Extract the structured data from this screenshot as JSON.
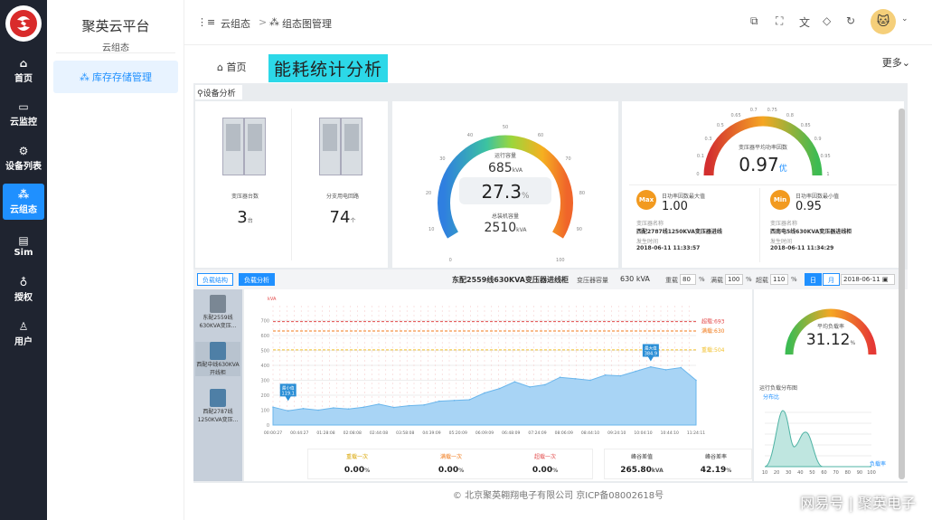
{
  "rail": {
    "items": [
      {
        "label": "首页",
        "icon": "home-icon"
      },
      {
        "label": "云监控",
        "icon": "monitor-icon"
      },
      {
        "label": "设备列表",
        "icon": "device-icon"
      },
      {
        "label": "云组态",
        "icon": "config-icon"
      },
      {
        "label": "Sim",
        "icon": "sim-icon"
      },
      {
        "label": "授权",
        "icon": "auth-icon"
      },
      {
        "label": "用户",
        "icon": "user-icon"
      }
    ]
  },
  "sidebar": {
    "title": "聚英云平台",
    "subtitle": "云组态",
    "menu_item": "库存存储管理"
  },
  "topbar": {
    "crumb1": "云组态",
    "crumb2": "组态图管理",
    "sep": ">"
  },
  "tabs": {
    "home": "首页",
    "page_title": "能耗统计分析",
    "more": "更多"
  },
  "section": {
    "title": "设备分析"
  },
  "card1": {
    "a_label": "变压器台数",
    "a_value": "3",
    "a_unit": "台",
    "b_label": "分支用电回路",
    "b_value": "74",
    "b_unit": "个"
  },
  "gauge1": {
    "top_label": "运行容量",
    "top_value": "685",
    "top_unit": "kVA",
    "percent": "27.3",
    "pct_sign": "%",
    "bottom_label": "总装机容量",
    "bottom_value": "2510",
    "bottom_unit": "kVA",
    "ticks": [
      "0",
      "10",
      "20",
      "30",
      "40",
      "50",
      "60",
      "70",
      "80",
      "90",
      "100"
    ]
  },
  "gauge2": {
    "label": "变压器平均功率因数",
    "value": "0.97",
    "badge": "优",
    "ticks": [
      "0",
      "0.1",
      "0.3",
      "0.5",
      "0.65",
      "0.7",
      "0.75",
      "0.8",
      "0.85",
      "0.9",
      "0.95",
      "1"
    ]
  },
  "maxmin": {
    "max": {
      "badge": "Max",
      "title": "日功率因数最大值",
      "value": "1.00",
      "name_label": "变压器名称",
      "name": "西配2787线1250KVA变压器进线",
      "time_label": "发生时间",
      "time": "2018-06-11 11:33:57"
    },
    "min": {
      "badge": "Min",
      "title": "日功率因数最小值",
      "value": "0.95",
      "name_label": "变压器名称",
      "name": "西南电5线630KVA变压器进线柜",
      "time_label": "发生时间",
      "time": "2018-06-11 11:34:29"
    }
  },
  "bar": {
    "tab1": "负载结构",
    "tab2": "负载分析",
    "device": "东配2559线630KVA变压器进线柜",
    "cap_label": "变压器容量",
    "cap_value": "630 kVA",
    "f1_label": "重载",
    "f1_value": "80",
    "f2_label": "满载",
    "f2_value": "100",
    "f3_label": "超载",
    "f3_value": "110",
    "pct": "%",
    "day": "日",
    "month": "月",
    "date": "2018-06-11"
  },
  "devices": [
    {
      "label": "东配2559线630KVA变压..."
    },
    {
      "label": "西配中线630KVA开线柜"
    },
    {
      "label": "西配2787线1250KVA变压..."
    }
  ],
  "chart_data": {
    "type": "area",
    "ylabel": "kVA",
    "ylim": [
      0,
      800
    ],
    "yticks": [
      "0",
      "100",
      "200",
      "300",
      "400",
      "500",
      "600",
      "700"
    ],
    "x": [
      "00:00:27",
      "00:44:27",
      "01:28:08",
      "02:08:08",
      "02:44:08",
      "03:58:08",
      "04:39:09",
      "05:20:09",
      "06:09:09",
      "06:48:09",
      "07:24:09",
      "08:06:09",
      "08:44:10",
      "09:24:10",
      "10:04:10",
      "10:44:10",
      "11:24:11"
    ],
    "values": [
      120,
      95,
      110,
      100,
      115,
      108,
      120,
      140,
      118,
      130,
      135,
      160,
      165,
      170,
      215,
      245,
      290,
      255,
      270,
      320,
      310,
      300,
      335,
      330,
      360,
      390,
      370,
      385,
      300
    ],
    "min_label": "最小值",
    "min_value": "119.1",
    "max_label": "最大值",
    "max_value": "384.9",
    "lines": [
      {
        "name": "超载",
        "value": 693,
        "text": "超载:693",
        "color": "#e34c4c"
      },
      {
        "name": "满载",
        "value": 630,
        "text": "满载:630",
        "color": "#f07a1a"
      },
      {
        "name": "重载",
        "value": 504,
        "text": "重载:504",
        "color": "#f2c12e"
      }
    ]
  },
  "stats": [
    {
      "label": "重载一次",
      "value": "0.00",
      "unit": "%",
      "color": "#f2c12e"
    },
    {
      "label": "满载一次",
      "value": "0.00",
      "unit": "%",
      "color": "#f07a1a"
    },
    {
      "label": "超载一次",
      "value": "0.00",
      "unit": "%",
      "color": "#e34c4c"
    },
    {
      "label": "峰谷差值",
      "value": "265.80",
      "unit": "kVA",
      "color": "#555"
    },
    {
      "label": "峰谷差率",
      "value": "42.19",
      "unit": "%",
      "color": "#555"
    }
  ],
  "gauge3": {
    "label": "平均负载率",
    "value": "31.12",
    "unit": "%"
  },
  "dist": {
    "title": "运行负载分布图",
    "ylabel": "分布比",
    "xlabel": "负载率",
    "xticks": [
      "10",
      "20",
      "30",
      "40",
      "50",
      "60",
      "70",
      "80",
      "90",
      "100"
    ]
  },
  "footer": {
    "text": "© 北京聚英翱翔电子有限公司   京ICP备08002618号"
  },
  "watermark": {
    "text": "网易号 | 聚英电子"
  }
}
